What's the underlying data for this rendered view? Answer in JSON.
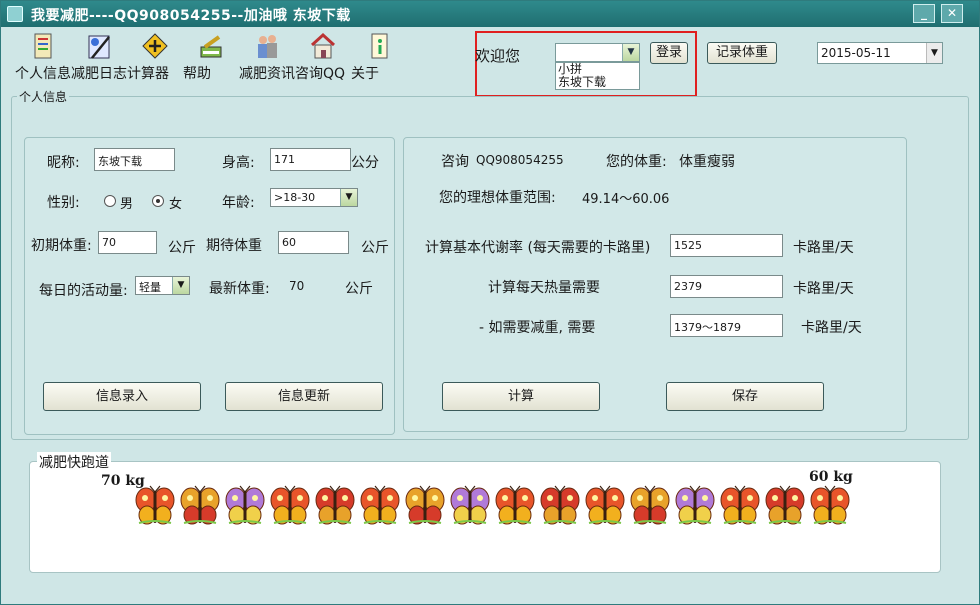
{
  "window": {
    "title": "我要减肥----QQ908054255--加油哦   东坡下载"
  },
  "toolbar": {
    "items": [
      {
        "label": "个人信息",
        "icon": "personal-info-icon"
      },
      {
        "label": "减肥日志",
        "icon": "diary-icon"
      },
      {
        "label": "计算器",
        "icon": "calculator-icon"
      },
      {
        "label": "帮助",
        "icon": "help-icon"
      },
      {
        "label": "减肥资讯",
        "icon": "news-icon"
      },
      {
        "label": "咨询QQ",
        "icon": "house-icon"
      },
      {
        "label": "关于",
        "icon": "about-icon"
      }
    ]
  },
  "login": {
    "welcome": "欢迎您",
    "user_value": "",
    "users": [
      "小拼",
      "东坡下载"
    ],
    "login_button": "登录",
    "record_button": "记录体重",
    "date": "2015-05-11"
  },
  "personal": {
    "group_title": "个人信息",
    "nickname_label": "昵称:",
    "nickname": "东坡下载",
    "height_label": "身高:",
    "height": "171",
    "height_unit": "公分",
    "gender_label": "性别:",
    "male": "男",
    "female": "女",
    "gender_selected": "female",
    "age_label": "年龄:",
    "age": ">18-30",
    "initial_weight_label": "初期体重:",
    "initial_weight": "70",
    "initial_weight_unit": "公斤",
    "target_weight_label": "期待体重",
    "target_weight": "60",
    "target_weight_unit": "公斤",
    "activity_label": "每日的活动量:",
    "activity": "轻量",
    "latest_weight_label": "最新体重:",
    "latest_weight": "70",
    "latest_weight_unit": "公斤",
    "enter_button": "信息录入",
    "update_button": "信息更新"
  },
  "calc": {
    "consult_label": "咨询",
    "consult_qq": "QQ908054255",
    "your_weight_label": "您的体重:",
    "your_weight_status": "体重瘦弱",
    "ideal_range_label": "您的理想体重范围:",
    "ideal_range": "49.14～60.06",
    "bmr_label": "计算基本代谢率 (每天需要的卡路里)",
    "bmr_value": "1525",
    "bmr_unit": "卡路里/天",
    "daily_label": "计算每天热量需要",
    "daily_value": "2379",
    "daily_unit": "卡路里/天",
    "lose_label": "- 如需要减重, 需要",
    "lose_value": "1379～1879",
    "lose_unit": "卡路里/天",
    "calc_button": "计算",
    "save_button": "保存"
  },
  "track": {
    "title": "减肥快跑道",
    "start": "70 kg",
    "end": "60 kg",
    "progress": 0
  },
  "colors": {
    "window_bg": "#cfe6e6",
    "titlebar": "#2f8a8c",
    "highlight_border": "#e02020"
  }
}
